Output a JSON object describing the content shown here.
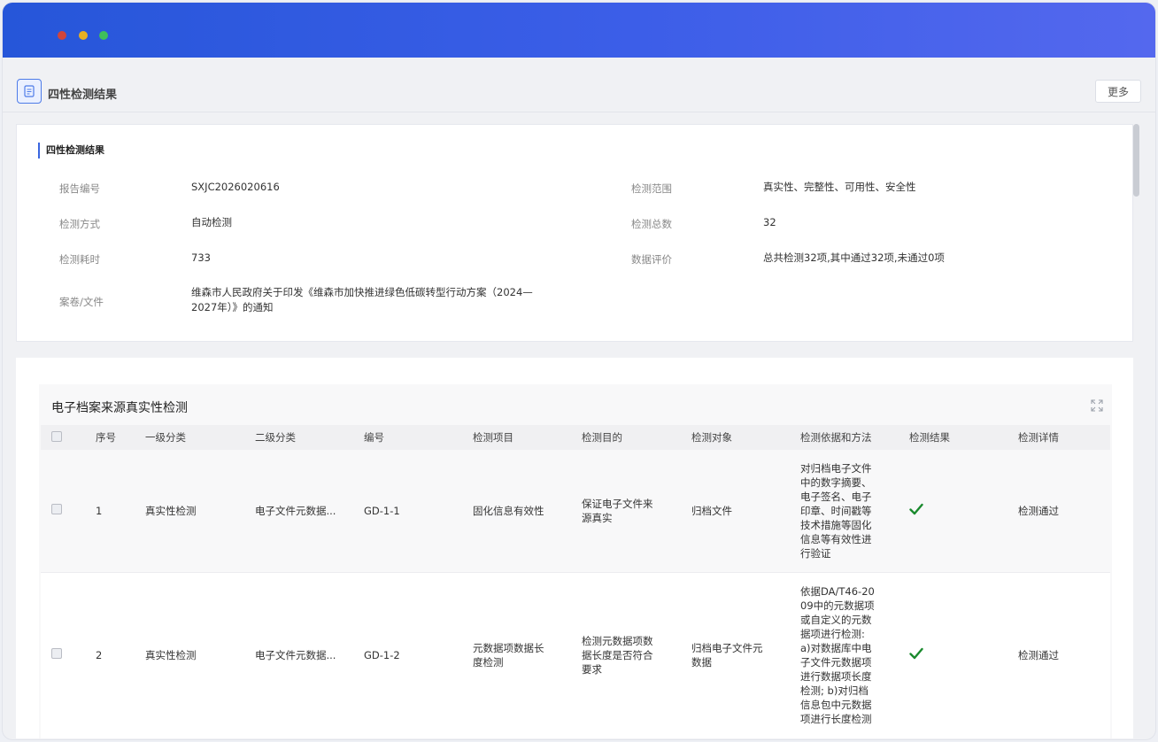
{
  "header": {
    "page_title": "四性检测结果",
    "more_label": "更多"
  },
  "info": {
    "section_title": "四性检测结果",
    "fields": [
      {
        "label": "报告编号",
        "value": "SXJC2026020616"
      },
      {
        "label": "检测范围",
        "value": "真实性、完整性、可用性、安全性"
      },
      {
        "label": "检测方式",
        "value": "自动检测"
      },
      {
        "label": "检测总数",
        "value": "32"
      },
      {
        "label": "检测耗时",
        "value": "733"
      },
      {
        "label": "数据评价",
        "value": "总共检测32项,其中通过32项,未通过0项"
      },
      {
        "label": "案卷/文件",
        "value": "维森市人民政府关于印发《维森市加快推进绿色低碳转型行动方案（2024—2027年）》的通知"
      }
    ]
  },
  "table": {
    "title": "电子档案来源真实性检测",
    "columns": [
      "序号",
      "一级分类",
      "二级分类",
      "编号",
      "检测项目",
      "检测目的",
      "检测对象",
      "检测依据和方法",
      "检测结果",
      "检测详情"
    ],
    "rows": [
      {
        "index": "1",
        "level1": "真实性检测",
        "level2": "电子文件元数据...",
        "code": "GD-1-1",
        "item": "固化信息有效性",
        "purpose": "保证电子文件来源真实",
        "object": "归档文件",
        "method": "对归档电子文件中的数字摘要、电子签名、电子印章、时间戳等技术措施等固化信息等有效性进行验证",
        "result_icon": "check-icon",
        "detail": "检测通过"
      },
      {
        "index": "2",
        "level1": "真实性检测",
        "level2": "电子文件元数据...",
        "code": "GD-1-2",
        "item": "元数据项数据长度检测",
        "purpose": "检测元数据项数据长度是否符合要求",
        "object": "归档电子文件元数据",
        "method": "依据DA/T46-2009中的元数据项或自定义的元数据项进行检测: a)对数据库中电子文件元数据项进行数据项长度检测; b)对归档信息包中元数据项进行长度检测",
        "result_icon": "check-icon",
        "detail": "检测通过"
      }
    ]
  },
  "colors": {
    "titlebar_start": "#2656d9",
    "titlebar_end": "#5468ee",
    "accent": "#3a66e0",
    "check": "#1a8a2e"
  }
}
